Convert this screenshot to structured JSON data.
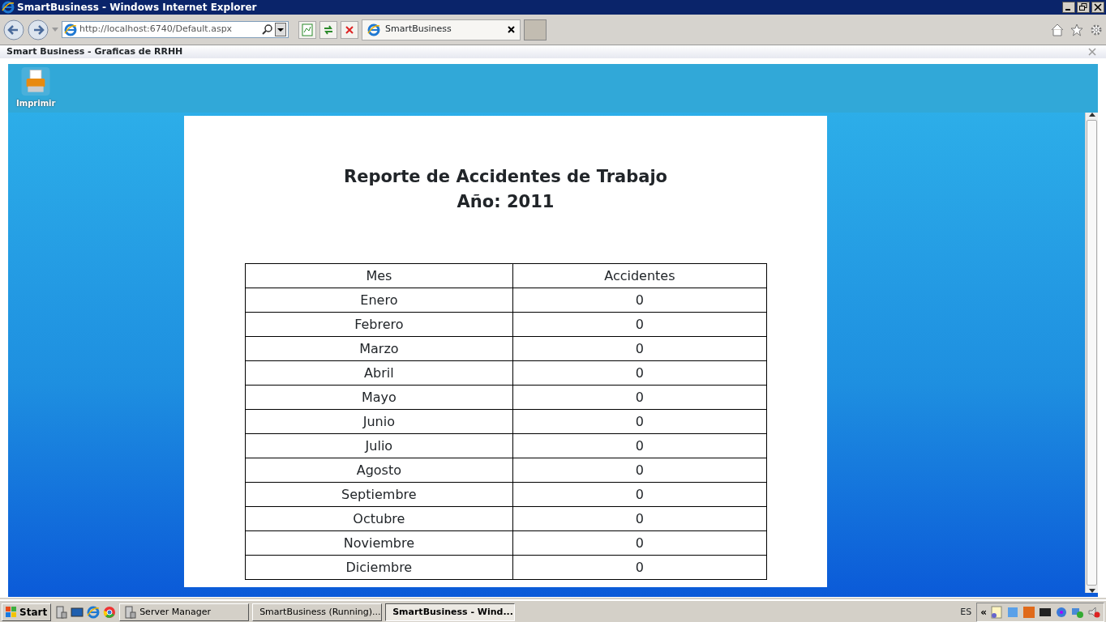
{
  "window": {
    "title": "SmartBusiness - Windows Internet Explorer"
  },
  "browser": {
    "address": "http://localhost:6740/Default.aspx",
    "tabs": [
      {
        "label": "SmartBusiness",
        "selected": true
      }
    ]
  },
  "dialog": {
    "title": "Smart Business - Graficas de RRHH"
  },
  "toolbar": {
    "buttons": [
      {
        "label": "Imprimir"
      }
    ]
  },
  "report": {
    "title_lines": [
      "Reporte de Accidentes de Trabajo",
      "Año: 2011"
    ],
    "table": {
      "columns": [
        "Mes",
        "Accidentes"
      ],
      "rows": [
        {
          "month": "Enero",
          "accidents": "0"
        },
        {
          "month": "Febrero",
          "accidents": "0"
        },
        {
          "month": "Marzo",
          "accidents": "0"
        },
        {
          "month": "Abril",
          "accidents": "0"
        },
        {
          "month": "Mayo",
          "accidents": "0"
        },
        {
          "month": "Junio",
          "accidents": "0"
        },
        {
          "month": "Julio",
          "accidents": "0"
        },
        {
          "month": "Agosto",
          "accidents": "0"
        },
        {
          "month": "Septiembre",
          "accidents": "0"
        },
        {
          "month": "Octubre",
          "accidents": "0"
        },
        {
          "month": "Noviembre",
          "accidents": "0"
        },
        {
          "month": "Diciembre",
          "accidents": "0"
        }
      ]
    }
  },
  "taskbar": {
    "start": "Start",
    "tasks": [
      {
        "label": "Server Manager",
        "kind": "server",
        "selected": false
      },
      {
        "label": "SmartBusiness (Running)...",
        "kind": "vm",
        "selected": false
      },
      {
        "label": "SmartBusiness - Wind...",
        "kind": "ie",
        "selected": true
      }
    ],
    "language": "ES",
    "tray_toggle": "«"
  }
}
